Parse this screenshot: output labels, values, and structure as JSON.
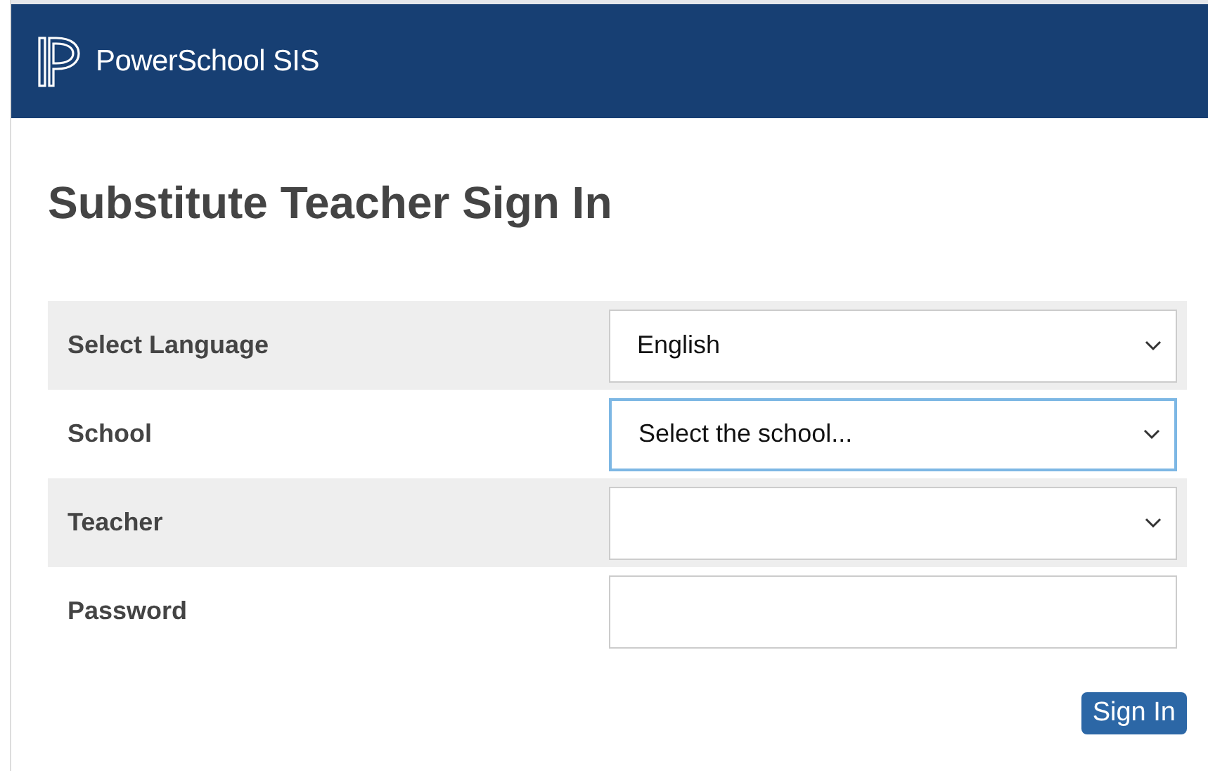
{
  "header": {
    "brand": "PowerSchool SIS"
  },
  "page_title": "Substitute Teacher Sign In",
  "form_rows": [
    {
      "label": "Select Language",
      "kind": "select",
      "value": "English",
      "focused": false
    },
    {
      "label": "School",
      "kind": "select",
      "value": "Select the school...",
      "focused": true
    },
    {
      "label": "Teacher",
      "kind": "select",
      "focused": false
    },
    {
      "label": "Password",
      "kind": "text",
      "focused": false
    }
  ],
  "submit_button": "Sign In"
}
